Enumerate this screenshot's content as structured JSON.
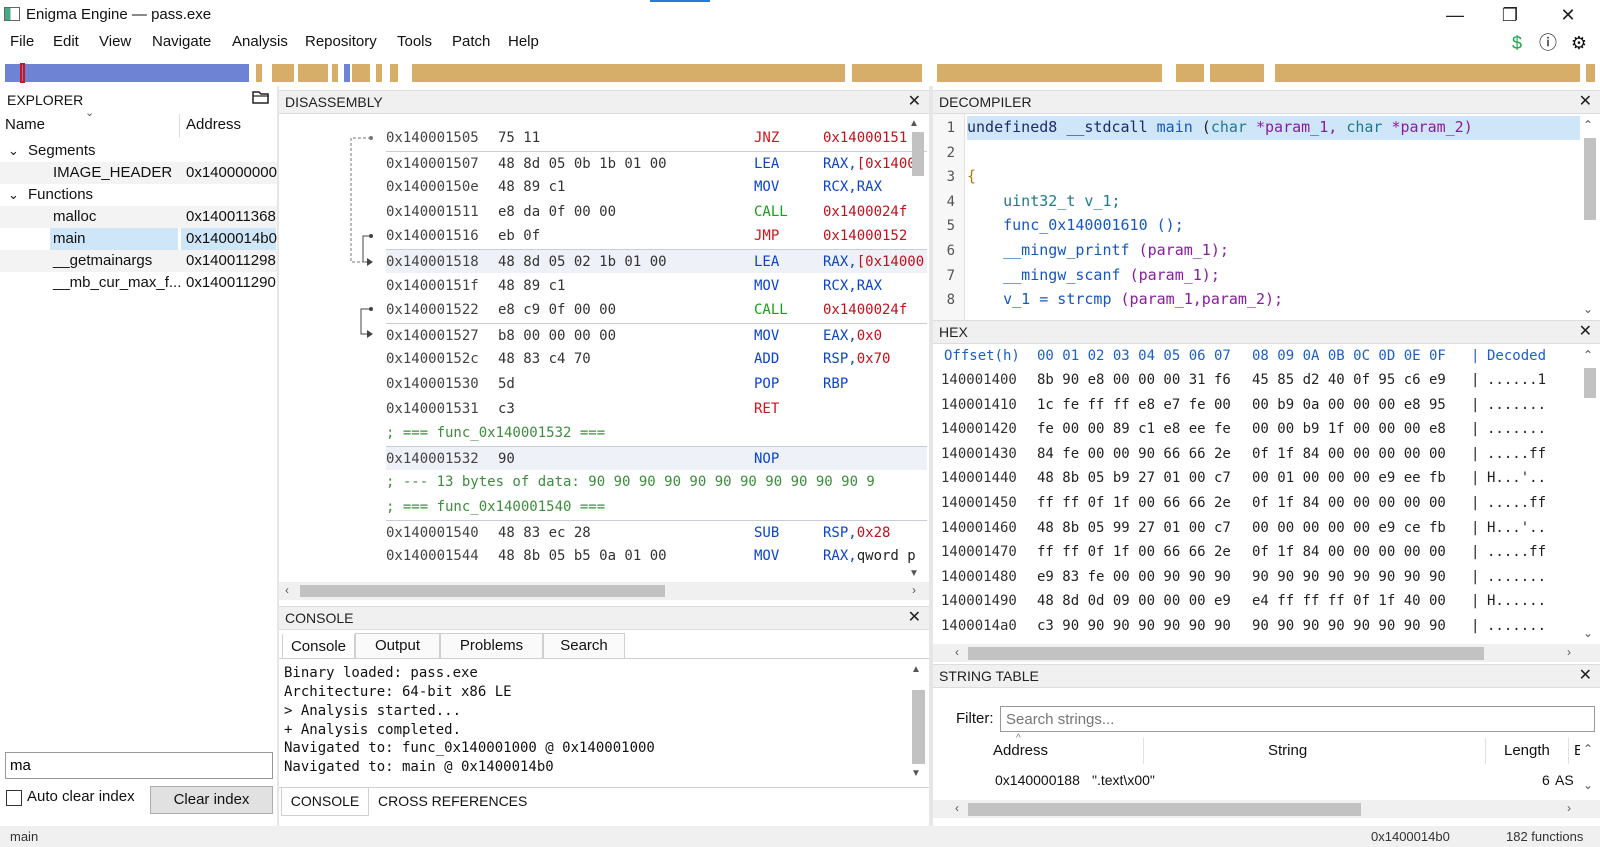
{
  "window": {
    "title": "Enigma Engine — pass.exe",
    "controls": {
      "minimize": "—",
      "restore": "❐",
      "close": "✕"
    }
  },
  "menu": [
    "File",
    "Edit",
    "View",
    "Navigate",
    "Analysis",
    "Repository",
    "Tools",
    "Patch",
    "Help"
  ],
  "toolbar_icons": [
    {
      "name": "dollar-icon",
      "glyph": "$",
      "color": "#1ea64a"
    },
    {
      "name": "info-icon",
      "glyph": "ⓘ",
      "color": "#222"
    },
    {
      "name": "gear-icon",
      "glyph": "⚙",
      "color": "#222"
    }
  ],
  "colors": {
    "nav_code": "#6f83d4",
    "nav_data": "#d6ae6a",
    "nav_marker": "#d0141a",
    "selection": "#cfe6f8",
    "highlight_line": "#cfe6f8"
  },
  "explorer": {
    "title": "EXPLORER",
    "col_name": "Name",
    "col_address": "Address",
    "tree": [
      {
        "type": "group",
        "label": "Segments",
        "expand": "⌄"
      },
      {
        "type": "item",
        "name": "IMAGE_HEADER",
        "address": "0x140000000",
        "selected": false
      },
      {
        "type": "group",
        "label": "Functions",
        "expand": "⌄"
      },
      {
        "type": "item",
        "name": "malloc",
        "address": "0x140011368",
        "selected": false
      },
      {
        "type": "item",
        "name": "main",
        "address": "0x1400014b0",
        "selected": true
      },
      {
        "type": "item",
        "name": "__getmainargs",
        "address": "0x140011298",
        "selected": false
      },
      {
        "type": "item",
        "name": "__mb_cur_max_f...",
        "address": "0x140011290",
        "selected": false
      }
    ],
    "search_value": "ma",
    "auto_clear_label": "Auto clear index",
    "auto_clear_checked": false,
    "clear_button": "Clear index"
  },
  "disassembly": {
    "title": "DISASSEMBLY",
    "rows": [
      {
        "kind": "code",
        "addr": "0x140001505",
        "bytes": "75 11",
        "mn": "JNZ",
        "mn_color": "red",
        "op": "0x14000151",
        "op_color": "red",
        "boxed": false,
        "hl": false
      },
      {
        "kind": "code",
        "addr": "0x140001507",
        "bytes": "48 8d 05 0b 1b 01 00",
        "mn": "LEA",
        "mn_color": "blue",
        "op": "RAX,[0x14000",
        "op_color": "mixed",
        "boxed": true,
        "hl": false
      },
      {
        "kind": "code",
        "addr": "0x14000150e",
        "bytes": "48 89 c1",
        "mn": "MOV",
        "mn_color": "blue",
        "op": "RCX,RAX",
        "op_color": "blue",
        "boxed": false,
        "hl": false
      },
      {
        "kind": "code",
        "addr": "0x140001511",
        "bytes": "e8 da 0f 00 00",
        "mn": "CALL",
        "mn_color": "green",
        "op": "0x1400024f",
        "op_color": "red",
        "boxed": false,
        "hl": false
      },
      {
        "kind": "code",
        "addr": "0x140001516",
        "bytes": "eb 0f",
        "mn": "JMP",
        "mn_color": "red",
        "op": "0x14000152",
        "op_color": "red",
        "boxed": false,
        "hl": false
      },
      {
        "kind": "code",
        "addr": "0x140001518",
        "bytes": "48 8d 05 02 1b 01 00",
        "mn": "LEA",
        "mn_color": "blue",
        "op": "RAX,[0x14000",
        "op_color": "mixed",
        "boxed": true,
        "hl": true
      },
      {
        "kind": "code",
        "addr": "0x14000151f",
        "bytes": "48 89 c1",
        "mn": "MOV",
        "mn_color": "blue",
        "op": "RCX,RAX",
        "op_color": "blue",
        "boxed": false,
        "hl": false
      },
      {
        "kind": "code",
        "addr": "0x140001522",
        "bytes": "e8 c9 0f 00 00",
        "mn": "CALL",
        "mn_color": "green",
        "op": "0x1400024f",
        "op_color": "red",
        "boxed": false,
        "hl": false
      },
      {
        "kind": "code",
        "addr": "0x140001527",
        "bytes": "b8 00 00 00 00",
        "mn": "MOV",
        "mn_color": "blue",
        "op": "EAX,0x0",
        "op_color": "mixed",
        "boxed": true,
        "hl": false
      },
      {
        "kind": "code",
        "addr": "0x14000152c",
        "bytes": "48 83 c4 70",
        "mn": "ADD",
        "mn_color": "blue",
        "op": "RSP,0x70",
        "op_color": "mixed",
        "boxed": false,
        "hl": false
      },
      {
        "kind": "code",
        "addr": "0x140001530",
        "bytes": "5d",
        "mn": "POP",
        "mn_color": "blue",
        "op": "RBP",
        "op_color": "blue",
        "boxed": false,
        "hl": false
      },
      {
        "kind": "code",
        "addr": "0x140001531",
        "bytes": "c3",
        "mn": "RET",
        "mn_color": "red",
        "op": "",
        "op_color": "blue",
        "boxed": false,
        "hl": false
      },
      {
        "kind": "comment",
        "text": "; === func_0x140001532 ===",
        "boxed": false
      },
      {
        "kind": "code",
        "addr": "0x140001532",
        "bytes": "90",
        "mn": "NOP",
        "mn_color": "blue",
        "op": "",
        "op_color": "blue",
        "boxed": true,
        "hl": true
      },
      {
        "kind": "comment",
        "text": "; --- 13 bytes of data: 90 90 90 90 90 90 90 90 90 90 90 9",
        "boxed": false
      },
      {
        "kind": "comment",
        "text": "; === func_0x140001540 ===",
        "boxed": false
      },
      {
        "kind": "code",
        "addr": "0x140001540",
        "bytes": "48 83 ec 28",
        "mn": "SUB",
        "mn_color": "blue",
        "op": "RSP,0x28",
        "op_color": "mixed",
        "boxed": true,
        "hl": false
      },
      {
        "kind": "code",
        "addr": "0x140001544",
        "bytes": "48 8b 05 b5 0a 01 00",
        "mn": "MOV",
        "mn_color": "blue",
        "op": "RAX,qword p",
        "op_color": "mixedq",
        "boxed": false,
        "hl": false
      }
    ]
  },
  "console": {
    "title": "CONSOLE",
    "tabs": [
      "Console",
      "Output",
      "Problems",
      "Search"
    ],
    "active_tab": 0,
    "lines": [
      "Binary loaded: pass.exe",
      "Architecture: 64-bit x86 LE",
      "> Analysis started...",
      "+ Analysis completed.",
      "Navigated to: func_0x140001000 @ 0x140001000",
      "Navigated to: main @ 0x1400014b0"
    ],
    "bottom_tabs": [
      "CONSOLE",
      "CROSS REFERENCES"
    ],
    "bottom_active": 0
  },
  "decompiler": {
    "title": "DECOMPILER",
    "lines": [
      {
        "n": "1",
        "parts": [
          {
            "t": "undefined8 __stdcall ",
            "c": "kw"
          },
          {
            "t": "main",
            "c": "fn"
          },
          {
            "t": " (",
            "c": "plain"
          },
          {
            "t": "char",
            "c": "type"
          },
          {
            "t": " *param_1, ",
            "c": "param"
          },
          {
            "t": "char",
            "c": "type"
          },
          {
            "t": " *param_2)",
            "c": "param"
          }
        ]
      },
      {
        "n": "2",
        "parts": []
      },
      {
        "n": "3",
        "parts": [
          {
            "t": "{",
            "c": "brace"
          }
        ]
      },
      {
        "n": "4",
        "parts": [
          {
            "t": "    uint32_t v_1;",
            "c": "type"
          }
        ]
      },
      {
        "n": "5",
        "parts": [
          {
            "t": "    func_0x140001610 ();",
            "c": "fn"
          }
        ]
      },
      {
        "n": "6",
        "parts": [
          {
            "t": "    __mingw_printf ",
            "c": "fn"
          },
          {
            "t": "(param_1);",
            "c": "param"
          }
        ]
      },
      {
        "n": "7",
        "parts": [
          {
            "t": "    __mingw_scanf ",
            "c": "fn"
          },
          {
            "t": "(param_1);",
            "c": "param"
          }
        ]
      },
      {
        "n": "8",
        "parts": [
          {
            "t": "    v_1 = strcmp ",
            "c": "fn"
          },
          {
            "t": "(param_1,param_2);",
            "c": "param"
          }
        ]
      }
    ]
  },
  "hex": {
    "title": "HEX",
    "header": {
      "offset": "Offset(h)",
      "cols_a": "00 01 02 03 04 05 06 07",
      "cols_b": "08 09 0A 0B 0C 0D 0E 0F",
      "sep": "|",
      "decoded": "Decoded"
    },
    "rows": [
      {
        "off": "140001400",
        "a": "8b 90 e8 00 00 00 31 f6",
        "b": "45 85 d2 40 0f 95 c6 e9",
        "dec": "......1"
      },
      {
        "off": "140001410",
        "a": "1c fe ff ff e8 e7 fe 00",
        "b": "00 b9 0a 00 00 00 e8 95",
        "dec": "......."
      },
      {
        "off": "140001420",
        "a": "fe 00 00 89 c1 e8 ee fe",
        "b": "00 00 b9 1f 00 00 00 e8",
        "dec": "......."
      },
      {
        "off": "140001430",
        "a": "84 fe 00 00 90 66 66 2e",
        "b": "0f 1f 84 00 00 00 00 00",
        "dec": ".....ff"
      },
      {
        "off": "140001440",
        "a": "48 8b 05 b9 27 01 00 c7",
        "b": "00 01 00 00 00 e9 ee fb",
        "dec": "H...'.."
      },
      {
        "off": "140001450",
        "a": "ff ff 0f 1f 00 66 66 2e",
        "b": "0f 1f 84 00 00 00 00 00",
        "dec": ".....ff"
      },
      {
        "off": "140001460",
        "a": "48 8b 05 99 27 01 00 c7",
        "b": "00 00 00 00 00 e9 ce fb",
        "dec": "H...'.."
      },
      {
        "off": "140001470",
        "a": "ff ff 0f 1f 00 66 66 2e",
        "b": "0f 1f 84 00 00 00 00 00",
        "dec": ".....ff"
      },
      {
        "off": "140001480",
        "a": "e9 83 fe 00 00 90 90 90",
        "b": "90 90 90 90 90 90 90 90",
        "dec": "......."
      },
      {
        "off": "140001490",
        "a": "48 8d 0d 09 00 00 00 e9",
        "b": "e4 ff ff ff 0f 1f 40 00",
        "dec": "H......"
      },
      {
        "off": "1400014a0",
        "a": "c3 90 90 90 90 90 90 90",
        "b": "90 90 90 90 90 90 90 90",
        "dec": "......."
      }
    ],
    "sep": "|"
  },
  "strings": {
    "title": "STRING TABLE",
    "filter_label": "Filter:",
    "filter_placeholder": "Search strings...",
    "col_address": "Address",
    "col_string": "String",
    "col_length": "Length",
    "col_extra": "E",
    "rows": [
      {
        "address": "0x140000188",
        "string": "\".text\\x00\"",
        "length": "6",
        "extra": "AS"
      }
    ]
  },
  "status": {
    "left": "main",
    "address": "0x1400014b0",
    "functions": "182 functions"
  }
}
